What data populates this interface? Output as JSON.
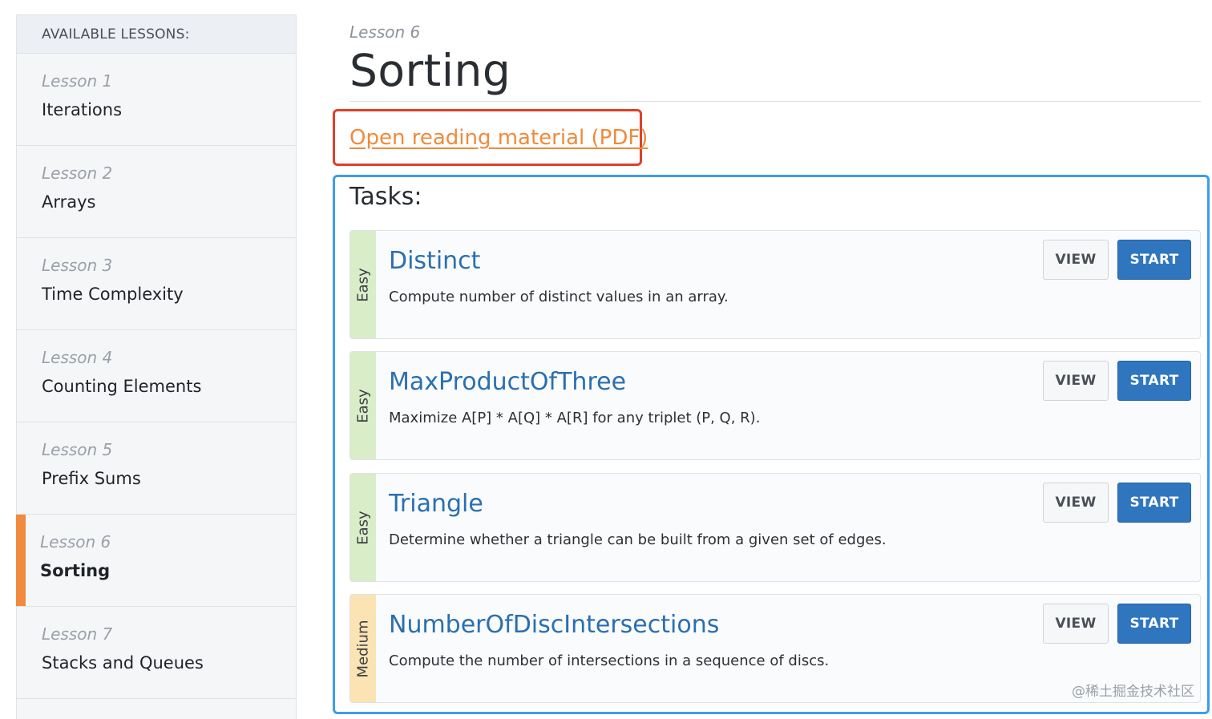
{
  "sidebar": {
    "header": "AVAILABLE LESSONS:",
    "lessons": [
      {
        "number": "Lesson 1",
        "title": "Iterations"
      },
      {
        "number": "Lesson 2",
        "title": "Arrays"
      },
      {
        "number": "Lesson 3",
        "title": "Time Complexity"
      },
      {
        "number": "Lesson 4",
        "title": "Counting Elements"
      },
      {
        "number": "Lesson 5",
        "title": "Prefix Sums"
      },
      {
        "number": "Lesson 6",
        "title": "Sorting",
        "active": true
      },
      {
        "number": "Lesson 7",
        "title": "Stacks and Queues"
      }
    ]
  },
  "main": {
    "lesson_label": "Lesson 6",
    "title": "Sorting",
    "pdf_link": "Open reading material (PDF)",
    "tasks_heading": "Tasks:",
    "tasks": [
      {
        "difficulty": "Easy",
        "name": "Distinct",
        "description": "Compute number of distinct values in an array.",
        "view_label": "VIEW",
        "start_label": "START"
      },
      {
        "difficulty": "Easy",
        "name": "MaxProductOfThree",
        "description": "Maximize A[P] * A[Q] * A[R] for any triplet (P, Q, R).",
        "view_label": "VIEW",
        "start_label": "START"
      },
      {
        "difficulty": "Easy",
        "name": "Triangle",
        "description": "Determine whether a triangle can be built from a given set of edges.",
        "view_label": "VIEW",
        "start_label": "START"
      },
      {
        "difficulty": "Medium",
        "name": "NumberOfDiscIntersections",
        "description": "Compute the number of intersections in a sequence of discs.",
        "view_label": "VIEW",
        "start_label": "START"
      }
    ]
  },
  "watermark": "@稀土掘金技术社区",
  "colors": {
    "accent_orange": "#f08a3c",
    "link_blue": "#2a6fb0",
    "start_button": "#2f76bf",
    "easy_band": "#d9edc8",
    "medium_band": "#fbe3b3",
    "highlight_red": "#e0402a",
    "highlight_blue": "#3d9ee8"
  }
}
